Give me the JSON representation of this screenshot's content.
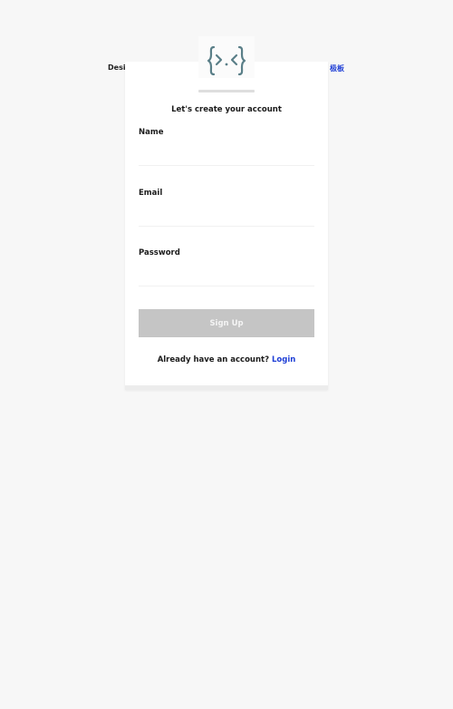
{
  "header": {
    "left_link_text": "Desig",
    "right_link_text": "极板"
  },
  "logo": {
    "glyph": "{>.<}"
  },
  "form": {
    "heading": "Let's create your account",
    "name_label": "Name",
    "name_value": "",
    "email_label": "Email",
    "email_value": "",
    "password_label": "Password",
    "password_value": "",
    "submit_label": "Sign Up"
  },
  "footer": {
    "prompt_text": "Already have an account?",
    "login_label": "Login"
  },
  "colors": {
    "background": "#f7f7f7",
    "card": "#ffffff",
    "button_disabled": "#c5c5c5",
    "link": "#1f3fd6",
    "logo": "#5a7f88"
  }
}
